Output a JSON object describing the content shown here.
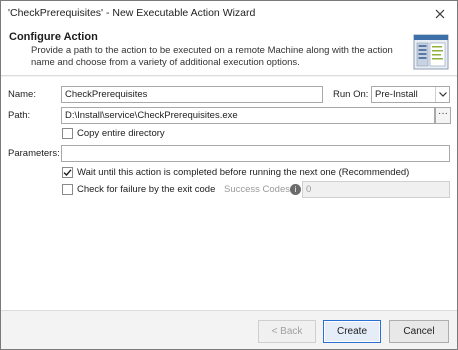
{
  "window": {
    "title": "'CheckPrerequisites' - New Executable Action Wizard"
  },
  "header": {
    "title": "Configure Action",
    "description": "Provide a path to the action to be executed on a remote Machine along with the action name and choose from a variety of additional execution options."
  },
  "form": {
    "name_label": "Name:",
    "name_value": "CheckPrerequisites",
    "run_on_label": "Run On:",
    "run_on_value": "Pre-Install",
    "path_label": "Path:",
    "path_value": "D:\\Install\\service\\CheckPrerequisites.exe",
    "browse_label": "···",
    "copy_dir_label": "Copy entire directory",
    "copy_dir_checked": false,
    "parameters_label": "Parameters:",
    "parameters_value": "",
    "wait_label": "Wait until this action is completed before running the next one (Recommended)",
    "wait_checked": true,
    "check_failure_label": "Check for failure by the exit code",
    "check_failure_checked": false,
    "success_codes_label": "Success Codes:",
    "success_codes_value": "0"
  },
  "footer": {
    "back_label": "< Back",
    "create_label": "Create",
    "cancel_label": "Cancel"
  },
  "colors": {
    "accent": "#2a6fd1",
    "header_bg": "#ffffff",
    "footer_bg": "#f3f3f3"
  }
}
